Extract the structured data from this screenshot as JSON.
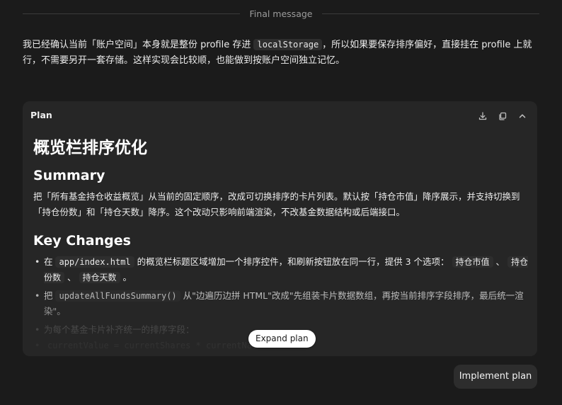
{
  "divider": {
    "label": "Final message"
  },
  "message": {
    "p1": "我已经确认当前「账户空间」本身就是整份 profile 存进 ",
    "code": "localStorage",
    "p2": "，所以如果要保存排序偏好，直接挂在 profile 上就行，不需要另开一套存储。这样实现会比较顺，也能做到按账户空间独立记忆。"
  },
  "plan": {
    "header_title": "Plan",
    "actions": [
      "download-icon",
      "copy-icon",
      "chevron-up-icon"
    ],
    "title": "概览栏排序优化",
    "summary_heading": "Summary",
    "summary_text": "把「所有基金持仓收益概览」从当前的固定顺序，改成可切换排序的卡片列表。默认按「持仓市值」降序展示，并支持切换到「持仓份数」和「持仓天数」降序。这个改动只影响前端渲染，不改基金数据结构或后端接口。",
    "changes_heading": "Key Changes",
    "item1": {
      "prefix": "在 ",
      "code": "app/index.html",
      "mid": " 的概览栏标题区域增加一个排序控件，和刷新按钮放在同一行，提供 3 个选项：",
      "opt1": "持仓市值",
      "sep1": "、",
      "opt2": "持仓份数",
      "sep2": "、",
      "opt3": "持仓天数",
      "end": "。"
    },
    "item2": {
      "prefix": "把 ",
      "code": "updateAllFundsSummary()",
      "text": " 从\"边遍历边拼 HTML\"改成\"先组装卡片数据数组，再按当前排序字段排序，最后统一渲染\"。"
    },
    "item3": {
      "text": "为每个基金卡片补齐统一的排序字段："
    },
    "item4": {
      "code": "currentValue = currentShares * currentNav"
    },
    "expand_label": "Expand plan"
  },
  "implement_label": "Implement plan"
}
